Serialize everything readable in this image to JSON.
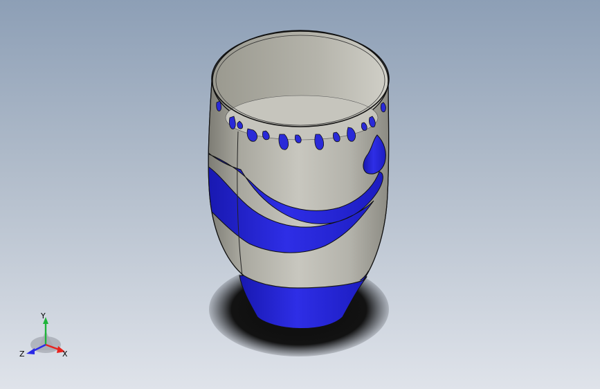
{
  "viewport": {
    "background_top": "#8d9fb6",
    "background_bottom": "#dfe3ea",
    "model": {
      "body_color": "#b9b8b0",
      "pattern_color": "#2a2ad8",
      "edge_color": "#1a1a1a"
    }
  },
  "triad": {
    "x_label": "X",
    "y_label": "Y",
    "z_label": "Z",
    "x_color": "#e8231e",
    "y_color": "#1fb43a",
    "z_color": "#2a2ae6"
  }
}
